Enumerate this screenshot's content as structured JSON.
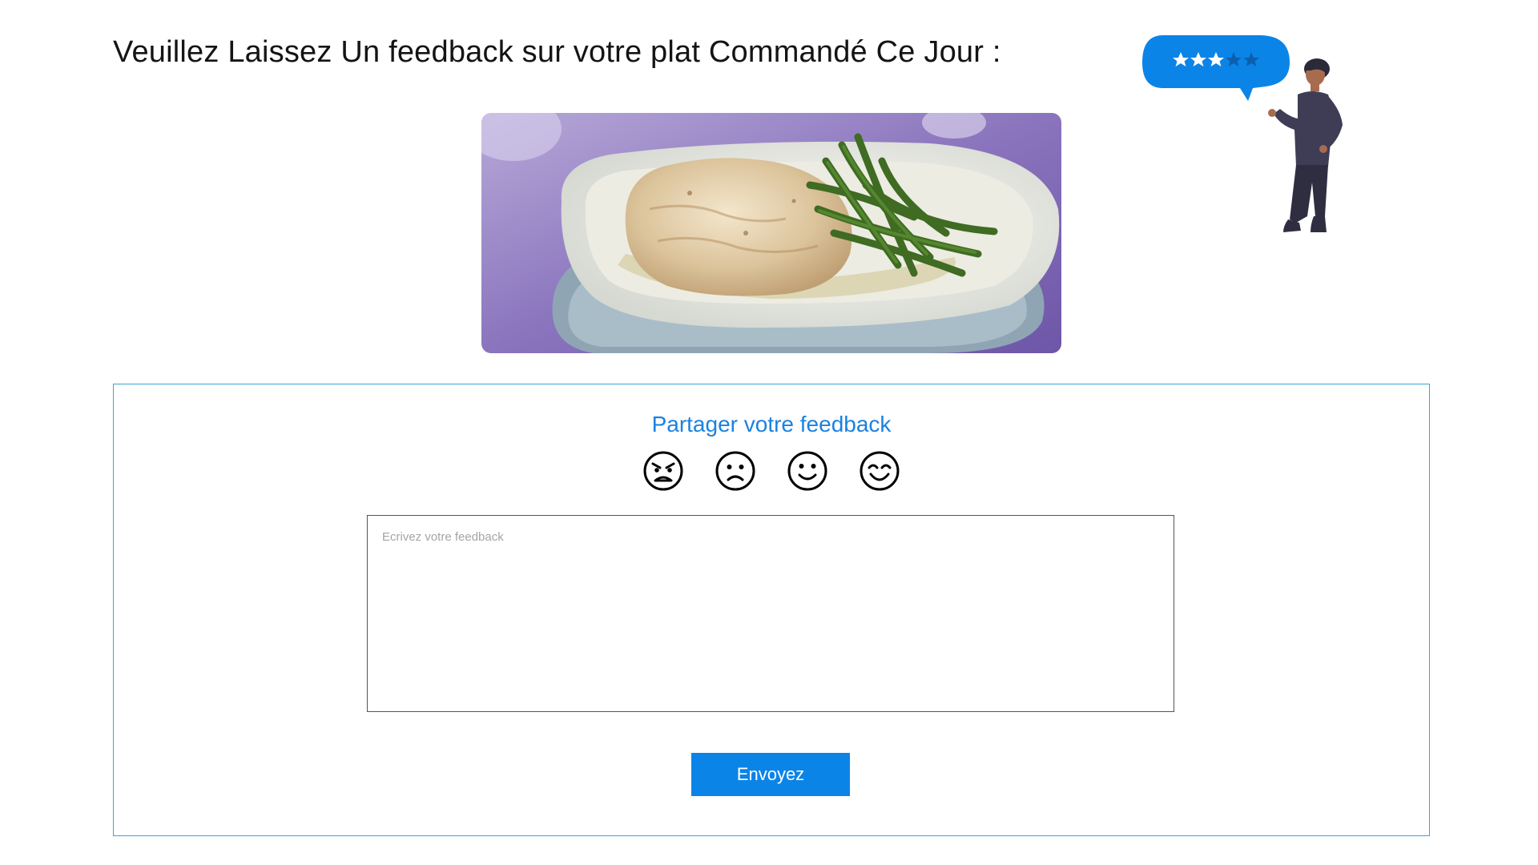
{
  "header": {
    "title": "Veuillez Laissez Un feedback sur votre plat Commandé Ce Jour :"
  },
  "illustration": {
    "rating_stars_filled": 3,
    "rating_stars_total": 5,
    "bubble_color": "#0b84e8"
  },
  "feedback": {
    "title": "Partager votre feedback",
    "emojis": [
      {
        "icon": "angry-face-icon"
      },
      {
        "icon": "sad-face-icon"
      },
      {
        "icon": "smiling-face-icon"
      },
      {
        "icon": "happy-face-icon"
      }
    ],
    "textarea": {
      "placeholder": "Ecrivez votre feedback",
      "value": ""
    },
    "submit_label": "Envoyez"
  },
  "colors": {
    "accent": "#1a82e2",
    "button": "#0b84e8",
    "card_border": "#3aa3d9"
  }
}
